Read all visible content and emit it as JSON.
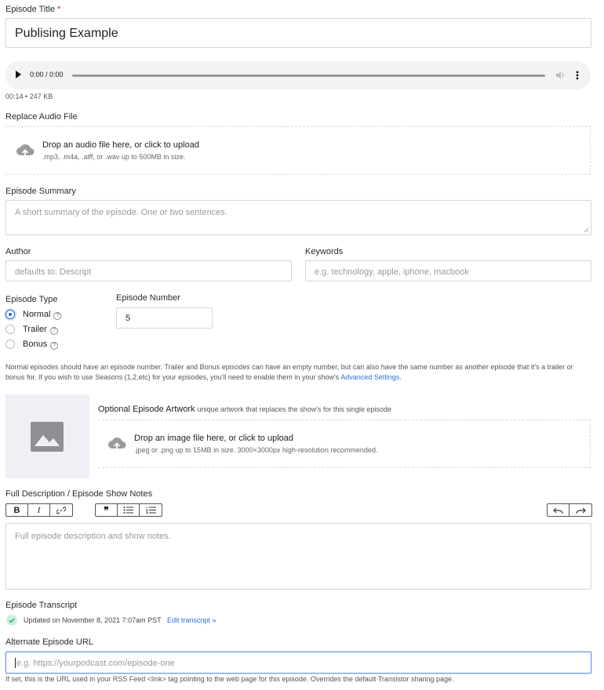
{
  "episode_title": {
    "label": "Episode Title",
    "required_mark": "*",
    "value": "Publising Example"
  },
  "audio": {
    "time": "0:00 / 0:00",
    "meta": "00:14 • 247 KB"
  },
  "replace_audio": {
    "label": "Replace Audio File",
    "title": "Drop an audio file here, or click to upload",
    "sub": ".mp3, .m4a, .aiff, or .wav up to 500MB in size."
  },
  "summary": {
    "label": "Episode Summary",
    "placeholder": "A short summary of the episode. One or two sentences."
  },
  "author": {
    "label": "Author",
    "placeholder": "defaults to: Descript"
  },
  "keywords": {
    "label": "Keywords",
    "placeholder": "e.g. technology, apple, iphone, macbook"
  },
  "episode_type": {
    "label": "Episode Type",
    "options": [
      {
        "label": "Normal",
        "selected": true
      },
      {
        "label": "Trailer",
        "selected": false
      },
      {
        "label": "Bonus",
        "selected": false
      }
    ]
  },
  "episode_number": {
    "label": "Episode Number",
    "value": "5"
  },
  "note": {
    "text": "Normal episodes should have an episode number. Trailer and Bonus episodes can have an empty number, but can also have the same number as another episode that it's a trailer or bonus for. If you wish to use Seasons (1,2,etc) for your episodes, you'll need to enable them in your show's ",
    "link": "Advanced Settings",
    "tail": "."
  },
  "artwork": {
    "label": "Optional Episode Artwork",
    "desc": "unique artwork that replaces the show's for this single episode",
    "title": "Drop an image file here, or click to upload",
    "sub": ".jpeg or .png up to 15MB in size. 3000×3000px high-resolution recommended."
  },
  "description": {
    "label": "Full Description / Episode Show Notes",
    "placeholder": "Full episode description and show notes.",
    "toolbar": {
      "bold": "B",
      "italic": "I",
      "quote": "❞"
    }
  },
  "transcript": {
    "label": "Episode Transcript",
    "status": "Updated on November 8, 2021 7:07am PST",
    "link": "Edit transcript »"
  },
  "alt_url": {
    "label": "Alternate Episode URL",
    "placeholder": "e.g. https://yourpodcast.com/episode-one",
    "help": "If set, this is the URL used in your RSS Feed <link> tag pointing to the web page for this episode. Overrides the default Transistor sharing page."
  },
  "colors": {
    "accent": "#2f6fd8",
    "required": "#e11d2a",
    "success": "#3fbf8a"
  }
}
